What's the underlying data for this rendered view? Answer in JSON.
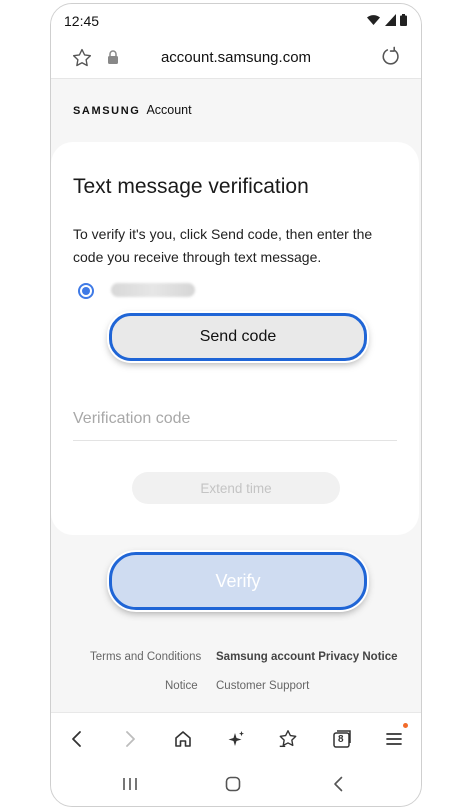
{
  "status_bar": {
    "time": "12:45"
  },
  "address_bar": {
    "url": "account.samsung.com"
  },
  "brand": {
    "logo_text": "SAMSUNG",
    "product": "Account"
  },
  "card": {
    "title": "Text message verification",
    "description": "To verify it's you, click Send code, then enter the code you receive through text message.",
    "send_code_label": "Send code",
    "verification_placeholder": "Verification code",
    "extend_time_label": "Extend time"
  },
  "verify_label": "Verify",
  "footer": {
    "terms": "Terms and Conditions",
    "privacy": "Samsung account Privacy Notice",
    "notice": "Notice",
    "support": "Customer Support"
  },
  "toolbar": {
    "tab_count": "8",
    "icons": [
      "back-icon",
      "forward-icon",
      "home-icon",
      "ai-sparkle-icon",
      "bookmarks-icon",
      "tabs-icon",
      "menu-icon"
    ]
  },
  "colors": {
    "accent": "#1f65d6",
    "radio": "#3f7ae6",
    "verify_fill": "#cfdcf1",
    "notification_dot": "#f26b2a"
  }
}
